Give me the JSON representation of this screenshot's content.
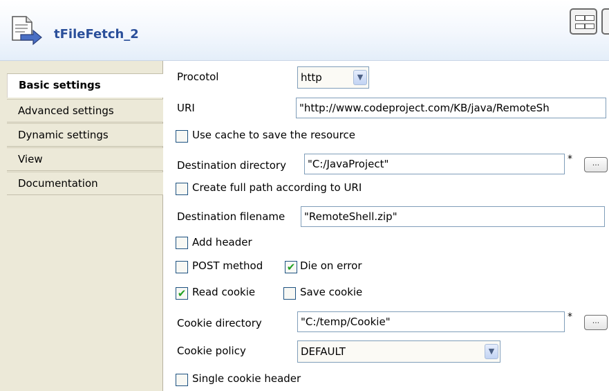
{
  "header": {
    "title": "tFileFetch_2",
    "icon": "file-fetch-icon"
  },
  "sidebar": {
    "items": [
      {
        "label": "Basic settings",
        "active": true
      },
      {
        "label": "Advanced settings"
      },
      {
        "label": "Dynamic settings"
      },
      {
        "label": "View"
      },
      {
        "label": "Documentation"
      }
    ]
  },
  "form": {
    "protocol": {
      "label": "Procotol",
      "value": "http"
    },
    "uri": {
      "label": "URI",
      "value": "\"http://www.codeproject.com/KB/java/RemoteSh"
    },
    "use_cache": {
      "label": "Use cache to save the resource",
      "checked": false
    },
    "destination_directory": {
      "label": "Destination directory",
      "value": "\"C:/JavaProject\""
    },
    "create_full_path": {
      "label": "Create full path according to URI",
      "checked": false
    },
    "destination_filename": {
      "label": "Destination filename",
      "value": "\"RemoteShell.zip\""
    },
    "add_header": {
      "label": "Add header",
      "checked": false
    },
    "post_method": {
      "label": "POST method",
      "checked": false
    },
    "die_on_error": {
      "label": "Die on error",
      "checked": true
    },
    "read_cookie": {
      "label": "Read cookie",
      "checked": true
    },
    "save_cookie": {
      "label": "Save cookie",
      "checked": false
    },
    "cookie_directory": {
      "label": "Cookie directory",
      "value": "\"C:/temp/Cookie\""
    },
    "cookie_policy": {
      "label": "Cookie policy",
      "value": "DEFAULT"
    },
    "single_cookie_header": {
      "label": "Single cookie header",
      "checked": false
    },
    "required_marker": "*",
    "browse_label": "..."
  },
  "colors": {
    "title": "#2a4f9a",
    "check": "#21a121",
    "sidebar_bg": "#ece9d8"
  }
}
